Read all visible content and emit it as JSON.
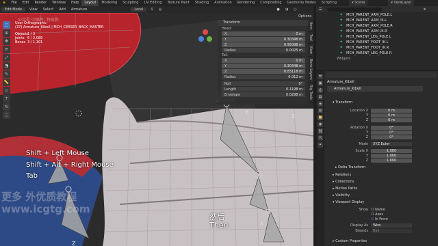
{
  "menubar": {
    "items": [
      "File",
      "Edit",
      "Render",
      "Window",
      "Help"
    ],
    "workspaces": [
      "Layout",
      "Modeling",
      "Sculpting",
      "UV Editing",
      "Texture Paint",
      "Shading",
      "Animation",
      "Rendering",
      "Compositing",
      "Geometry Nodes",
      "Scripting"
    ],
    "active_workspace": "Layout",
    "scene": "Scene",
    "view_layer": "ViewLayer"
  },
  "viewport": {
    "mode": "Edit Mode",
    "menus": [
      "View",
      "Select",
      "Add",
      "Armature"
    ],
    "orientation": "Local",
    "options_label": "Options",
    "info": {
      "view_name": "User Orthographic",
      "object_path": "(37) Armature_Kibell | MCH_CERSER_BACK_MASTER",
      "objects": "1 / 3",
      "joints": "6 / 2,089",
      "bones": "3 / 1,101",
      "objects_label": "Objects",
      "joints_label": "Joints",
      "bones_label": "Bones"
    },
    "shortcuts": [
      "Shift + Left Mouse",
      "Shift + Alt + Right Mouse",
      "Tab"
    ],
    "subtitle_cn": "然后",
    "subtitle_en": "Then",
    "watermark_top": "公众号 中插件, 特效狗",
    "watermark_cn": "更多 外优质教程",
    "watermark_en": "www.icgtg.com",
    "axis_labels": [
      "X",
      "Y",
      "Z"
    ]
  },
  "transform_panel": {
    "title": "Transform",
    "head_label": "Head:",
    "tail_label": "Tail:",
    "head": [
      {
        "label": "X",
        "value": "0 m"
      },
      {
        "label": "Y",
        "value": "0.30348 m"
      },
      {
        "label": "Z",
        "value": "0.95098 m"
      },
      {
        "label": "Radius",
        "value": "0.0025 m"
      }
    ],
    "tail": [
      {
        "label": "X",
        "value": "0 m"
      },
      {
        "label": "Y",
        "value": "0.30348 m"
      },
      {
        "label": "Z",
        "value": "0.83118 m"
      },
      {
        "label": "Radius",
        "value": "0.012 m"
      }
    ],
    "extra": [
      {
        "label": "Roll",
        "value": "0°"
      },
      {
        "label": "Length",
        "value": "0.1198 m"
      },
      {
        "label": "Envelope",
        "value": "0.0298 m"
      }
    ],
    "tabs": [
      "Item",
      "Tool",
      "View",
      "Bone Layers",
      "Rig Tools"
    ]
  },
  "outliner": {
    "items": [
      "MCH_PARENT_ARM_POLE.L",
      "MCH_PARENT_ARM_IK.L",
      "MCH_PARENT_ARM_POLE.R",
      "MCH_PARENT_ARM_IK.R",
      "MCH_PARENT_LEG_POLE.L",
      "MCH_PARENT_FOOT_IK.L",
      "MCH_PARENT_FOOT_IK.R",
      "MCH_PARENT_LEG_POLE.R",
      "Widgets"
    ]
  },
  "properties": {
    "object_name": "Armature_Kibell",
    "data_name": "Armature_Kibell",
    "sections": {
      "transform": "Transform",
      "delta": "Delta Transform",
      "relations": "Relations",
      "collections": "Collections",
      "motion_paths": "Motion Paths",
      "visibility": "Visibility",
      "viewport_display": "Viewport Display",
      "custom_properties": "Custom Properties"
    },
    "location_label": "Location X",
    "location": [
      "0 m",
      "0 m",
      "0 m"
    ],
    "rotation_label": "Rotation X",
    "rotation": [
      "0°",
      "0°",
      "0°"
    ],
    "mode_label": "Mode",
    "mode_value": "XYZ Euler",
    "scale_label": "Scale X",
    "scale": [
      "1.000",
      "1.000",
      "1.000"
    ],
    "axis_short": [
      "Y",
      "Z"
    ],
    "show_label": "Show",
    "show_options": [
      "Name",
      "Axes",
      "In Front"
    ],
    "display_as_label": "Display As",
    "display_as_value": "Wire",
    "bounds_label": "Bounds",
    "bounds_value": "Box"
  },
  "colors": {
    "accent": "#4772b3",
    "red_object": "#b8242c",
    "blue_object": "#2e4a86",
    "mesh_cloth": "#c8c1c3",
    "bone_green": "#3fb36f"
  }
}
